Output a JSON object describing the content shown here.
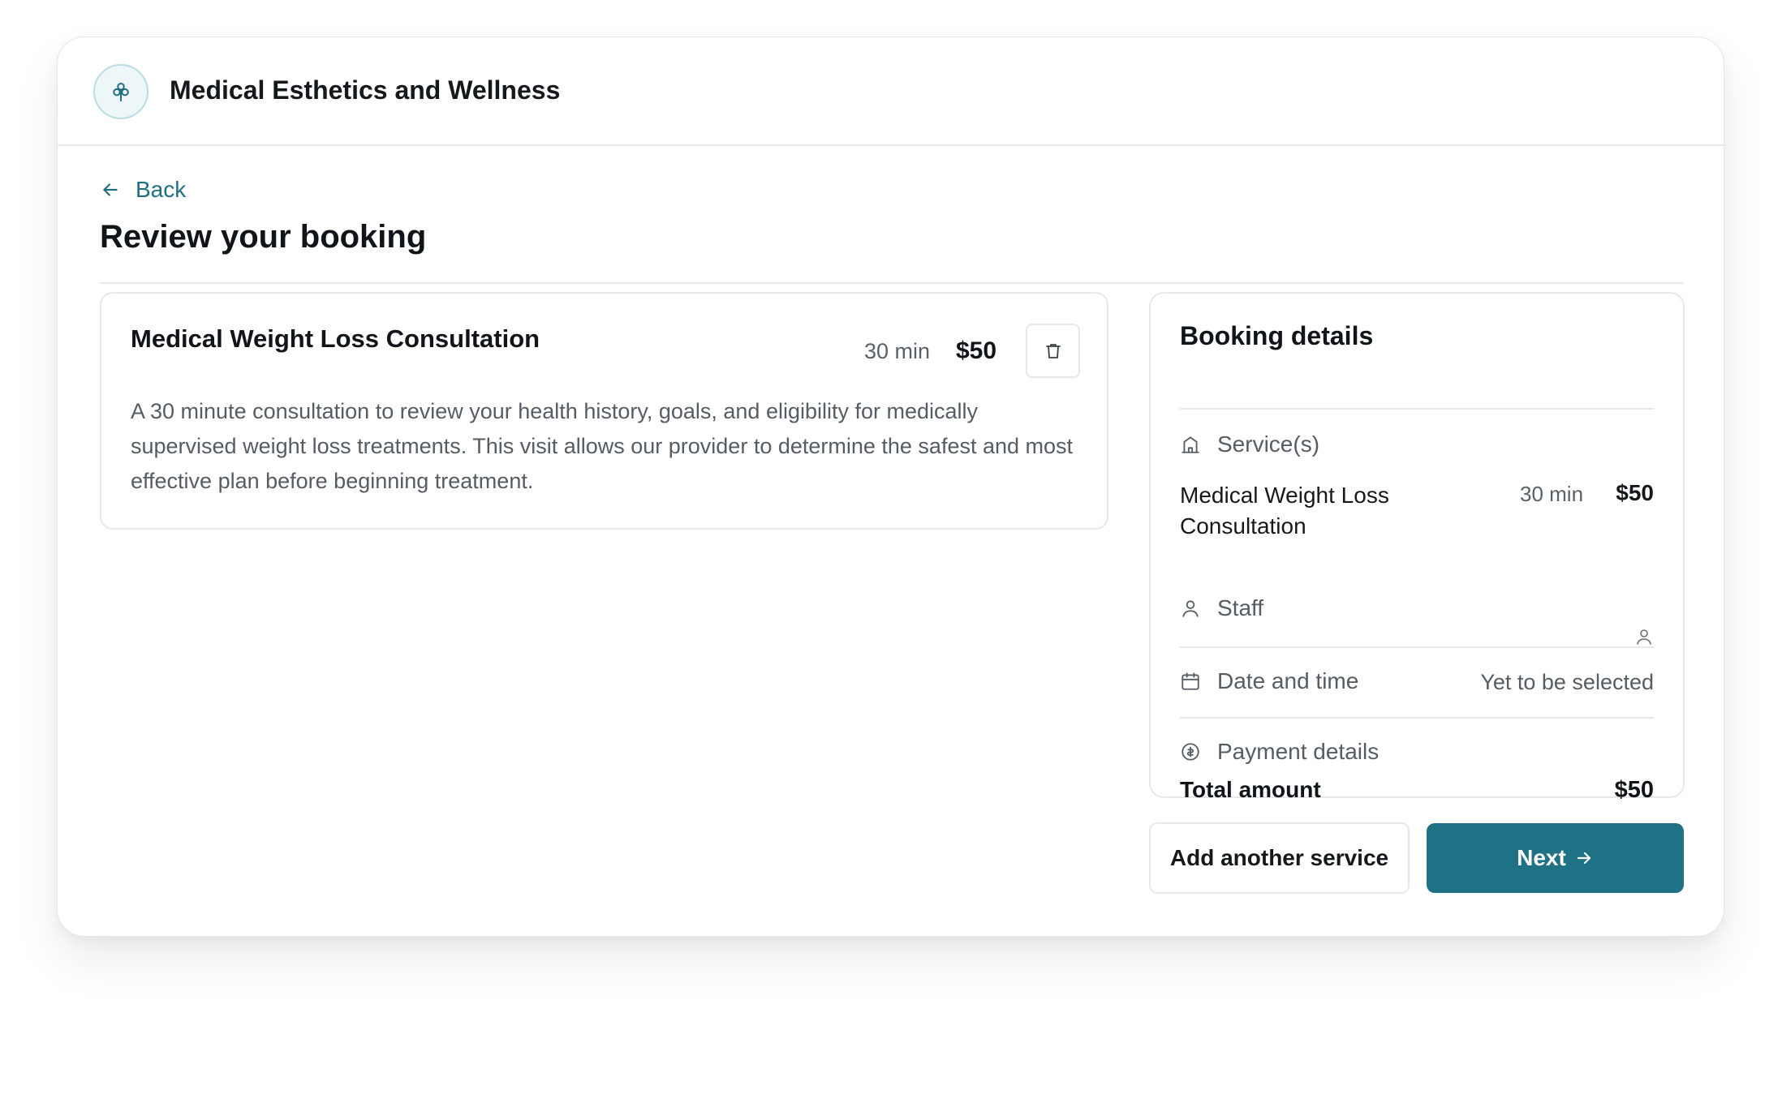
{
  "header": {
    "brand_name": "Medical Esthetics and Wellness",
    "logo_icon": "flower-icon"
  },
  "nav": {
    "back_label": "Back"
  },
  "page": {
    "title": "Review your booking"
  },
  "service": {
    "name": "Medical Weight Loss Consultation",
    "duration": "30 min",
    "price": "$50",
    "description": "A 30 minute consultation to review your health history, goals, and eligibility for medically supervised weight loss treatments. This visit allows our provider to determine the safest and most effective plan before beginning treatment."
  },
  "booking_details": {
    "title": "Booking details",
    "services_label": "Service(s)",
    "service_name": "Medical Weight Loss Consultation",
    "service_duration": "30 min",
    "service_price": "$50",
    "staff_label": "Staff",
    "datetime_label": "Date and time",
    "datetime_value": "Yet to be selected",
    "payment_label": "Payment details",
    "total_label": "Total amount",
    "total_value": "$50"
  },
  "actions": {
    "add_service_label": "Add another service",
    "next_label": "Next"
  },
  "colors": {
    "accent": "#1f7285",
    "link": "#1f6f82"
  }
}
